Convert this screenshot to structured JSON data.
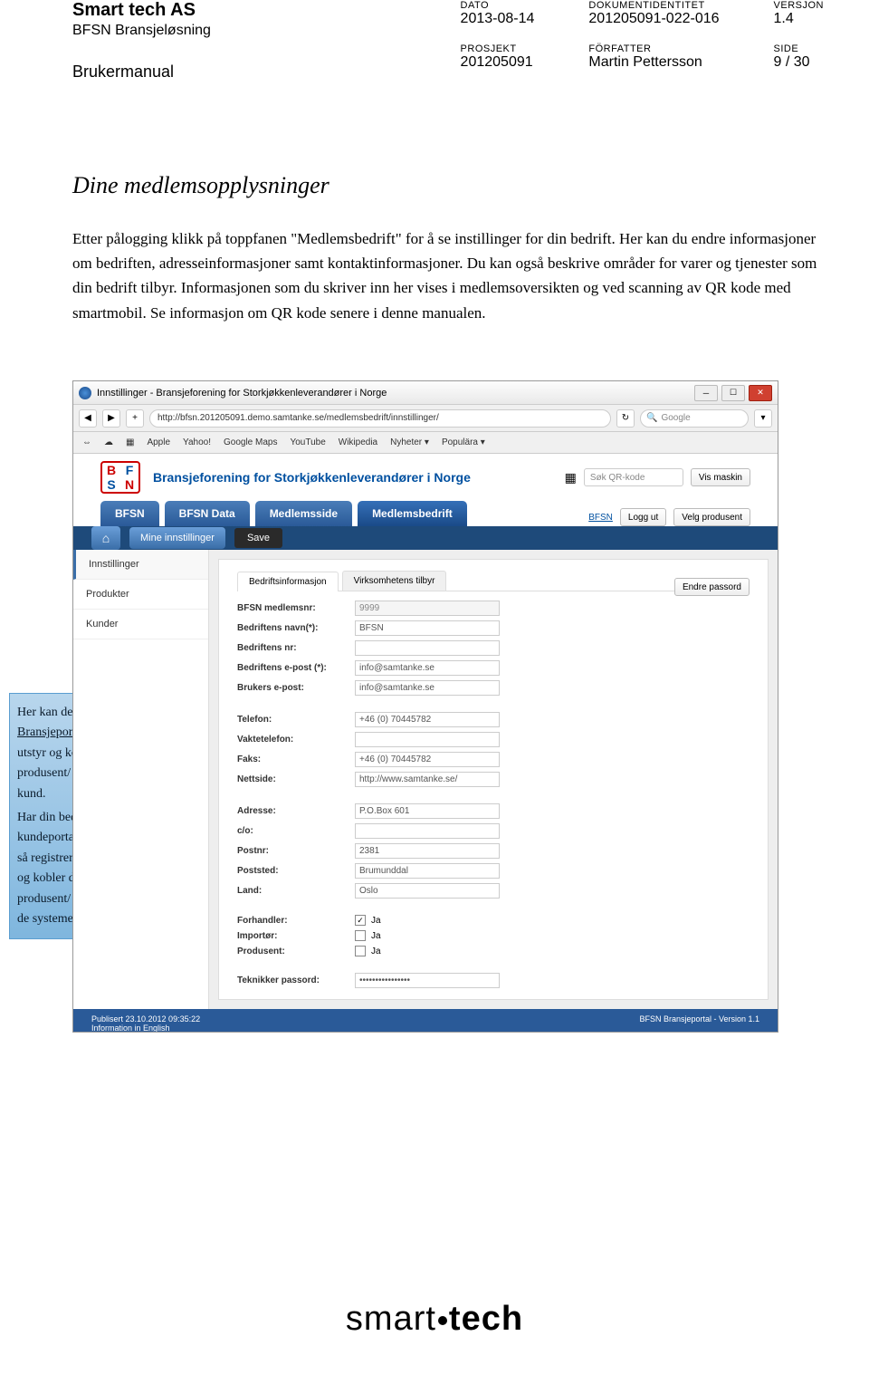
{
  "header": {
    "company": "Smart tech AS",
    "product": "BFSN Bransjeløsning",
    "manual": "Brukermanual",
    "cols": [
      {
        "l1": "DATO",
        "v1": "2013-08-14",
        "l2": "PROSJEKT",
        "v2": "201205091"
      },
      {
        "l1": "DOKUMENTIDENTITET",
        "v1": "201205091-022-016",
        "l2": "FÖRFATTER",
        "v2": "Martin Pettersson"
      },
      {
        "l1": "VERSJON",
        "v1": "1.4",
        "l2": "SIDE",
        "v2": "9 / 30"
      }
    ]
  },
  "section": {
    "title": "Dine medlemsopplysninger",
    "body": "Etter pålogging klikk på toppfanen \"Medlemsbedrift\" for å se instillinger for din bedrift. Her kan du endre informasjoner om bedriften, adresseinformasjoner samt kontaktinformasjoner. Du kan også beskrive områder for varer og tjenester som din bedrift tilbyr. Informasjonen som du skriver inn her vises i medlemsoversikten og ved scanning av QR kode med smartmobil. Se informasjon om QR kode senere i denne manualen."
  },
  "callout": {
    "p1a": "Her kan den som ",
    "p1u": "kun har Bransjeportal",
    "p1b": " registrere inn utstyr og koble de til QR og produsent/ produkt og kund.",
    "p2": "Har din bedrift kundeportal/servise system så registrerer du inn utstyr og kobler de til QR og produsent/ produkt, kunde i de systemen e."
  },
  "browser": {
    "title": "Innstillinger - Bransjeforening for Storkjøkkenleverandører i Norge",
    "url": "http://bfsn.201205091.demo.samtanke.se/medlemsbedrift/innstillinger/",
    "search_placeholder": "Google",
    "bookmarks": [
      "Apple",
      "Yahoo!",
      "Google Maps",
      "YouTube",
      "Wikipedia",
      "Nyheter ▾",
      "Populära ▾"
    ]
  },
  "site": {
    "name": "Bransjeforening for Storkjøkkenleverandører i Norge",
    "logo": [
      "B",
      "F",
      "S",
      "N"
    ],
    "qr_search": "Søk QR-kode",
    "vis_maskin": "Vis maskin",
    "main_tabs": [
      "BFSN",
      "BFSN Data",
      "Medlemsside",
      "Medlemsbedrift"
    ],
    "bfsn_link": "BFSN",
    "logout": "Logg ut",
    "velg": "Velg produsent",
    "sub_tab": "Mine innstillinger",
    "save": "Save",
    "sidebar": [
      "Innstillinger",
      "Produkter",
      "Kunder"
    ],
    "inner_tabs": [
      "Bedriftsinformasjon",
      "Virksomhetens tilbyr"
    ],
    "change_pw": "Endre passord",
    "form": {
      "medlemsnr_l": "BFSN medlemsnr:",
      "medlemsnr_v": "9999",
      "navn_l": "Bedriftens navn(*):",
      "navn_v": "BFSN",
      "nr_l": "Bedriftens nr:",
      "nr_v": "",
      "epost_l": "Bedriftens e-post (*):",
      "epost_v": "info@samtanke.se",
      "bepost_l": "Brukers e-post:",
      "bepost_v": "info@samtanke.se",
      "tel_l": "Telefon:",
      "tel_v": "+46 (0) 70445782",
      "vakt_l": "Vaktetelefon:",
      "vakt_v": "",
      "faks_l": "Faks:",
      "faks_v": "+46 (0) 70445782",
      "nett_l": "Nettside:",
      "nett_v": "http://www.samtanke.se/",
      "adr_l": "Adresse:",
      "adr_v": "P.O.Box 601",
      "co_l": "c/o:",
      "co_v": "",
      "postnr_l": "Postnr:",
      "postnr_v": "2381",
      "poststed_l": "Poststed:",
      "poststed_v": "Brumunddal",
      "land_l": "Land:",
      "land_v": "Oslo",
      "forh_l": "Forhandler:",
      "forh_v": "Ja",
      "forh_c": true,
      "imp_l": "Importør:",
      "imp_v": "Ja",
      "imp_c": false,
      "prod_l": "Produsent:",
      "prod_v": "Ja",
      "prod_c": false,
      "tekn_l": "Teknikker passord:",
      "tekn_v": "••••••••••••••••"
    },
    "footer_pub": "Publisert 23.10.2012 09:35:22",
    "footer_info": "Information in English",
    "footer_ver": "BFSN Bransjeportal - Version 1.1"
  },
  "footer_logo": {
    "a": "smart",
    "b": "tech"
  }
}
